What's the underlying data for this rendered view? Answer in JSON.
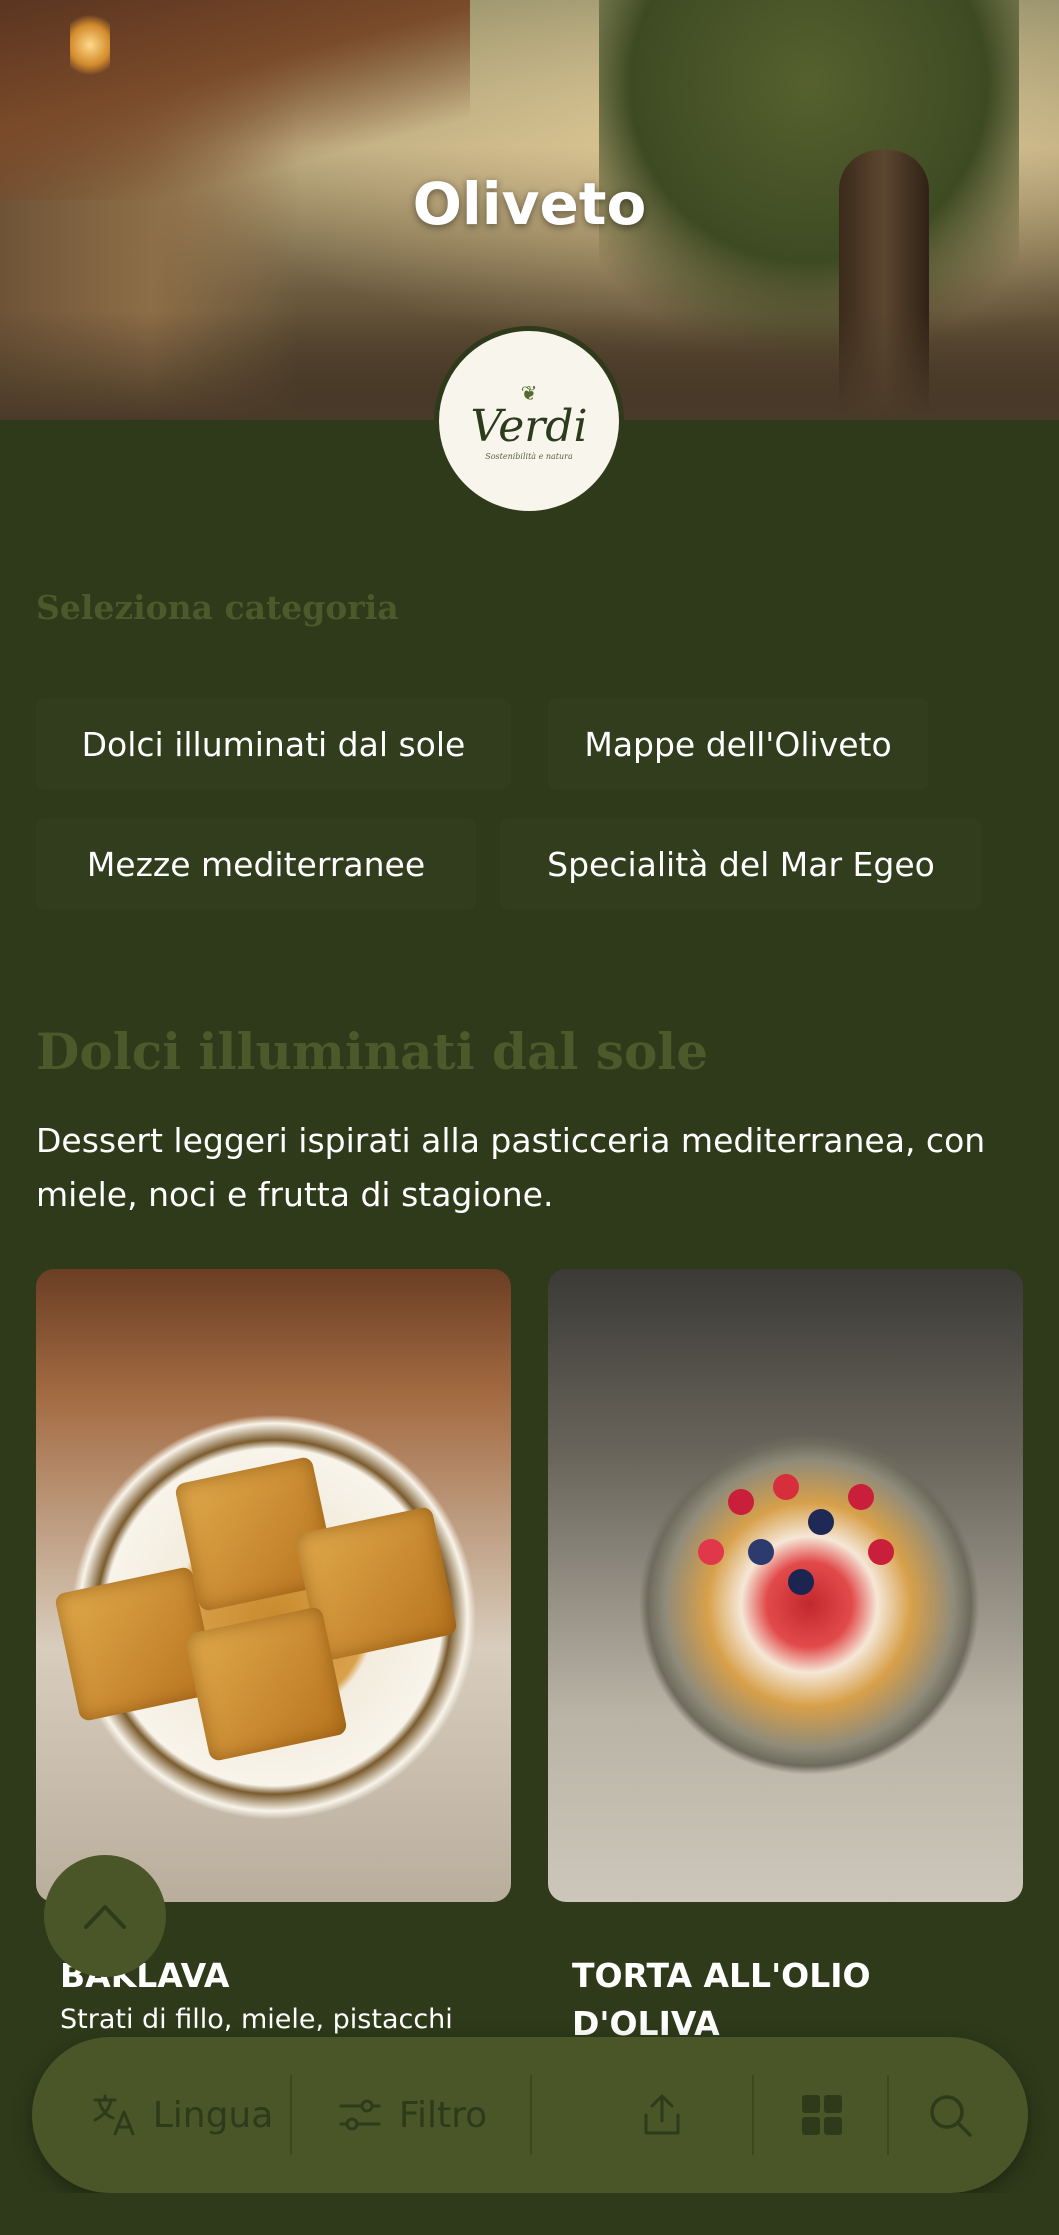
{
  "hero": {
    "title": "Oliveto",
    "logo": {
      "name": "Verdi",
      "tagline": "Sostenibilità e natura"
    }
  },
  "categories": {
    "label": "Seleziona categoria",
    "items": [
      "Dolci illuminati dal sole",
      "Mappe dell'Oliveto",
      "Mezze mediterranee",
      "Specialità del Mar Egeo"
    ]
  },
  "section": {
    "title": "Dolci illuminati dal sole",
    "description": "Dessert leggeri ispirati alla pasticceria mediterranea, con miele, noci e frutta di stagione."
  },
  "products": [
    {
      "title": "BAKLAVA",
      "subtitle": "Strati di fillo, miele, pistacchi"
    },
    {
      "title": "TORTA ALL'OLIO D'OLIVA",
      "subtitle": ""
    }
  ],
  "bottom_bar": {
    "language_label": "Lingua",
    "filter_label": "Filtro"
  },
  "icons": {
    "scroll_top": "chevron-up-icon",
    "language": "translate-icon",
    "filter": "sliders-icon",
    "share": "share-icon",
    "grid": "grid-icon",
    "search": "search-icon"
  },
  "colors": {
    "background": "#2f3a1a",
    "accent_text": "#4b5a2a",
    "bar": "#4a5628"
  }
}
